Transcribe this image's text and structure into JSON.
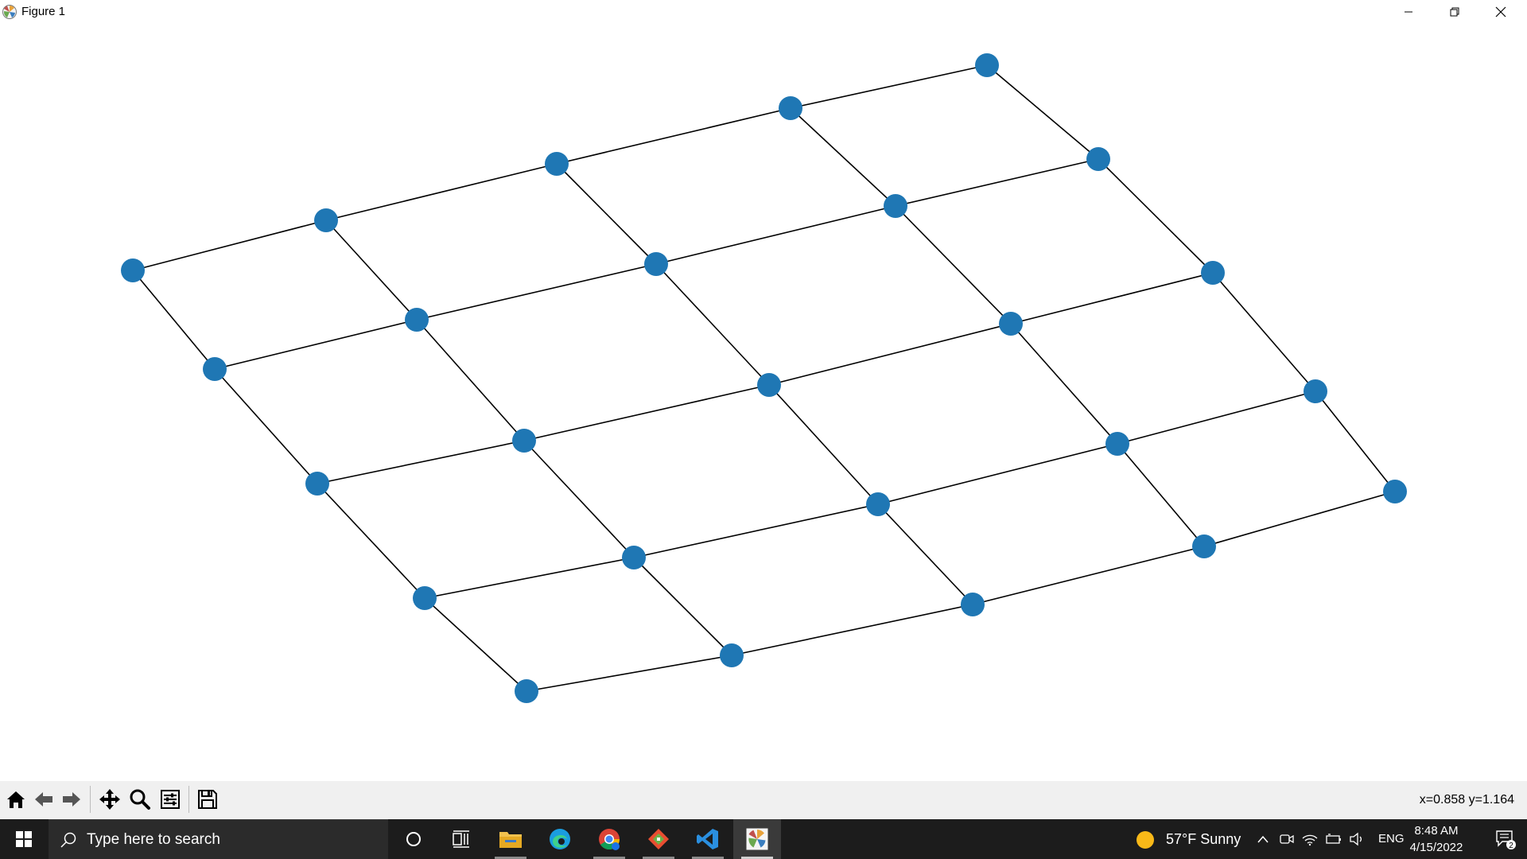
{
  "window": {
    "title": "Figure 1",
    "controls": [
      "minimize",
      "restore",
      "close"
    ]
  },
  "figure": {
    "type": "network-graph",
    "node_color": "#1f77b4",
    "edge_color": "#000000",
    "grid_rows": 5,
    "grid_cols": 5
  },
  "toolbar": {
    "buttons": [
      "home-icon",
      "back-icon",
      "forward-icon",
      "pan-icon",
      "zoom-icon",
      "configure-subplots-icon",
      "save-icon"
    ],
    "coords": "x=0.858 y=1.164"
  },
  "taskbar": {
    "search_placeholder": "Type here to search",
    "weather": "57°F  Sunny",
    "language": "ENG",
    "time": "8:48 AM",
    "date": "4/15/2022",
    "notification_count": "2"
  }
}
